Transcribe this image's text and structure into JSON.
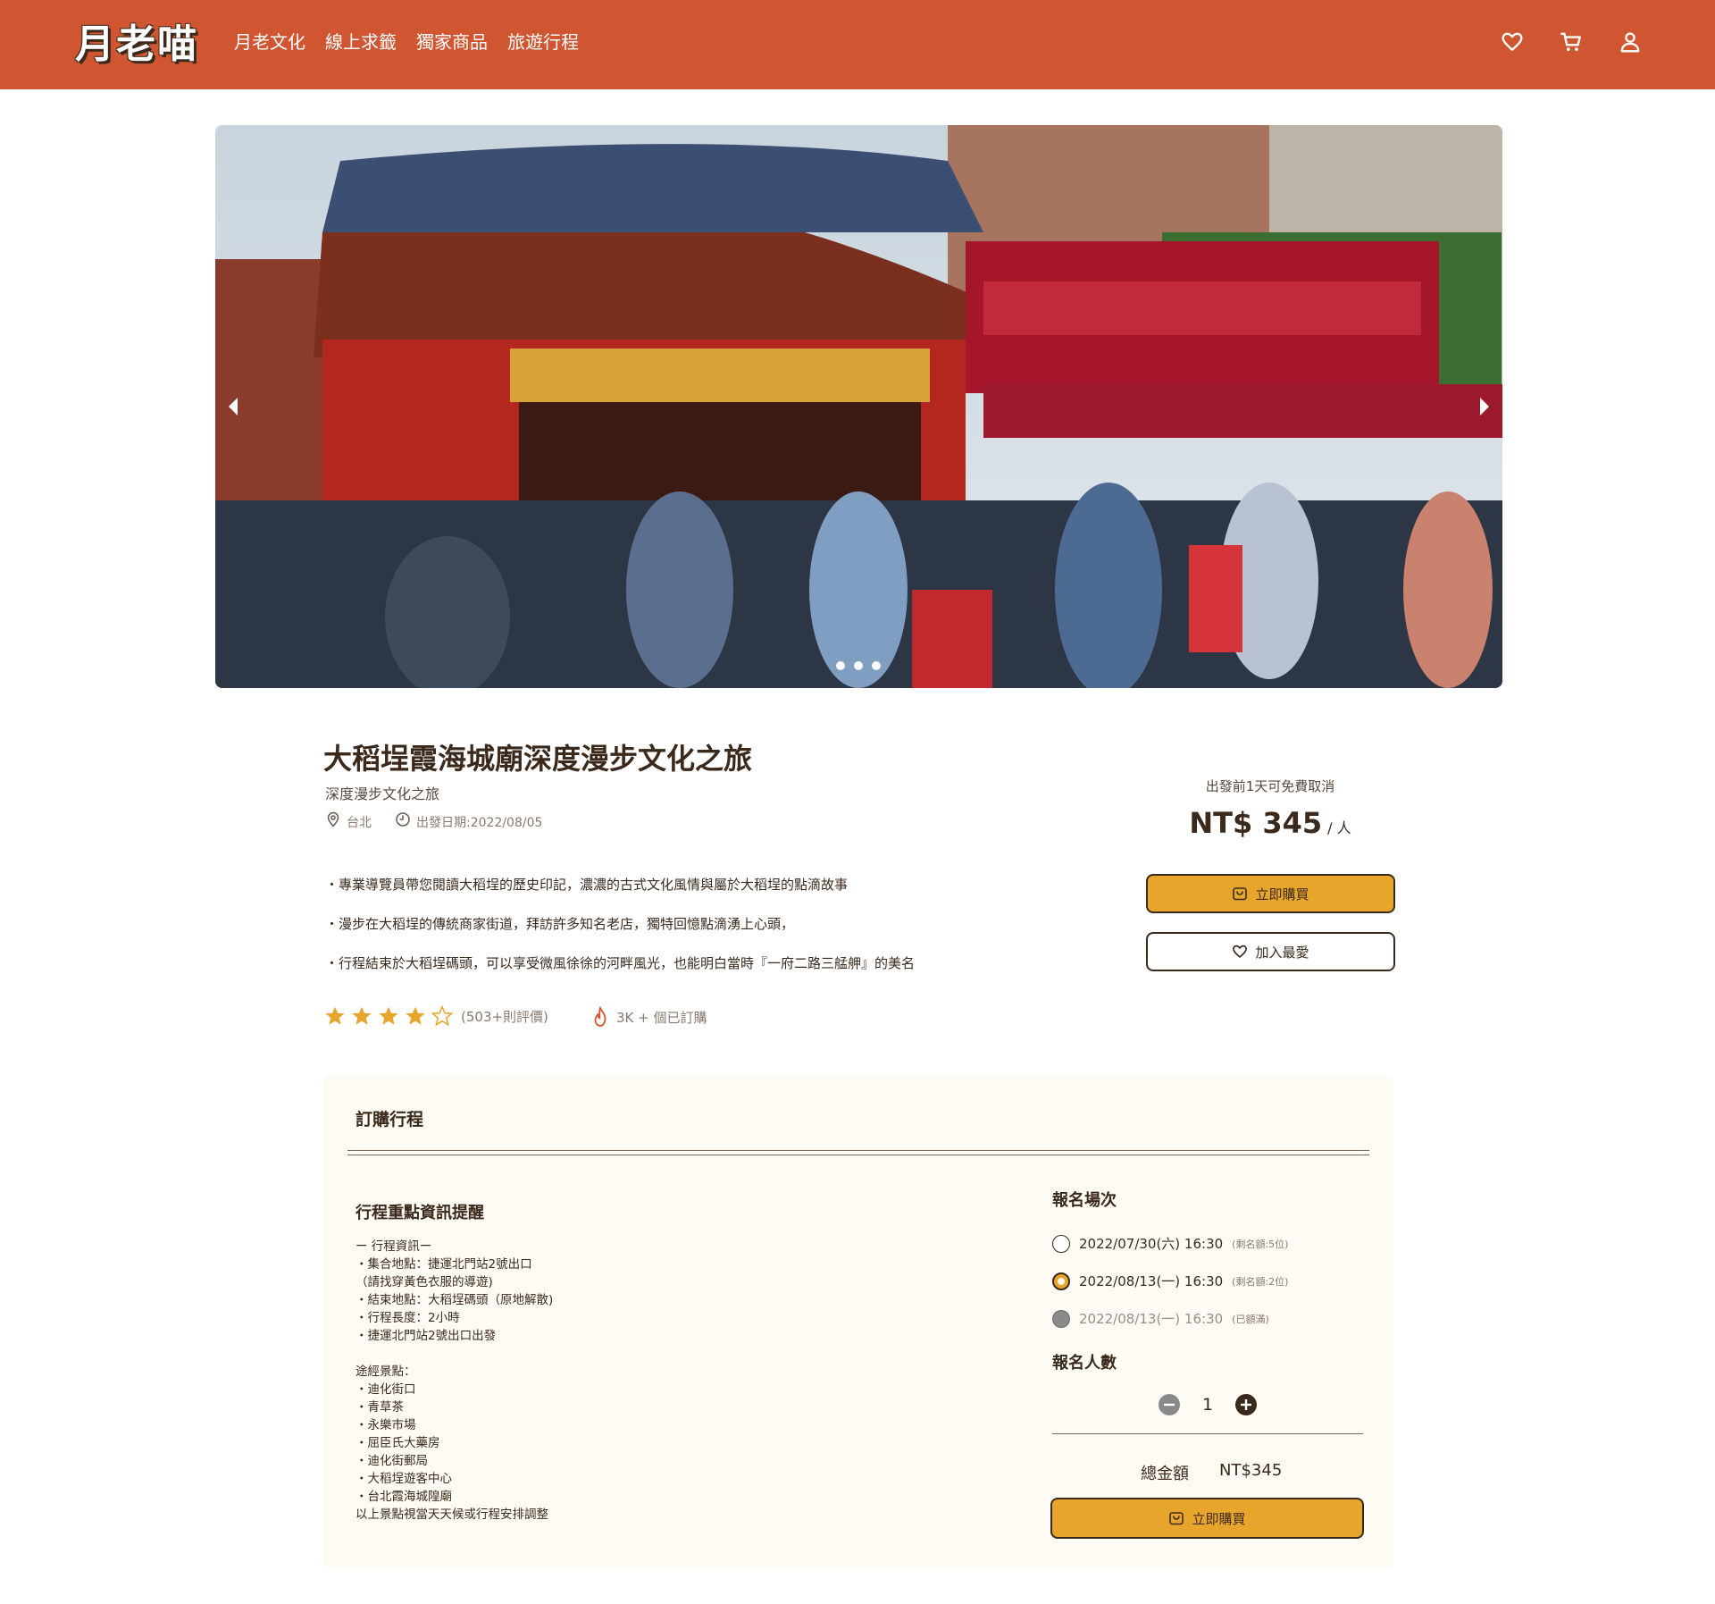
{
  "header": {
    "logo": "月老喵",
    "nav": [
      "月老文化",
      "線上求籤",
      "獨家商品",
      "旅遊行程"
    ],
    "icons": [
      "heart-icon",
      "cart-icon",
      "user-icon"
    ]
  },
  "carousel": {
    "dots": 3
  },
  "product": {
    "title": "大稻埕霞海城廟深度漫步文化之旅",
    "subtitle": "深度漫步文化之旅",
    "location": "台北",
    "date": "出發日期:2022/08/05",
    "description": [
      "・專業導覽員帶您閱讀大稻埕的歷史印記，濃濃的古式文化風情與屬於大稻埕的點滴故事",
      "・漫步在大稻埕的傳統商家街道，拜訪許多知名老店，獨特回憶點滴湧上心頭，",
      "・行程結束於大稻埕碼頭，可以享受微風徐徐的河畔風光，也能明白當時『一府二路三艋舺』的美名"
    ],
    "rating": {
      "stars": 4,
      "max": 5,
      "reviews": "(503+則評價)"
    },
    "sold": "3K + 個已訂購"
  },
  "purchase": {
    "cancel_note": "出發前1天可免費取消",
    "price": "NT$ 345",
    "per": "/ 人",
    "buy_label": "立即購買",
    "fav_label": "加入最愛"
  },
  "order": {
    "title": "訂購行程",
    "info_title": "行程重點資訊提醒",
    "info_lines": [
      "ー 行程資訊ー",
      "・集合地點：捷運北門站2號出口",
      "（請找穿黃色衣服的導遊)",
      "・結束地點：大稻埕碼頭（原地解散)",
      "・行程長度：2小時",
      "・捷運北門站2號出口出發",
      "",
      "途經景點：",
      "・迪化街口",
      "・青草茶",
      "・永樂市場",
      "・屈臣氏大藥房",
      "・迪化街郵局",
      "・大稻埕遊客中心",
      "・台北霞海城隍廟",
      "以上景點視當天天候或行程安排調整"
    ],
    "sessions_title": "報名場次",
    "sessions": [
      {
        "label": "2022/07/30(六) 16:30",
        "note": "(剩名額:5位)",
        "state": "available"
      },
      {
        "label": "2022/08/13(一) 16:30",
        "note": "(剩名額:2位)",
        "state": "selected"
      },
      {
        "label": "2022/08/13(一) 16:30",
        "note": "(已額滿)",
        "state": "full"
      }
    ],
    "qty_title": "報名人數",
    "qty": "1",
    "total_label": "總金額",
    "total_value": "NT$345",
    "buy_label": "立即購買"
  },
  "colors": {
    "brand": "#cf5630",
    "accent": "#e8a52c",
    "text": "#3b2a1c",
    "card": "#fefbf5"
  }
}
